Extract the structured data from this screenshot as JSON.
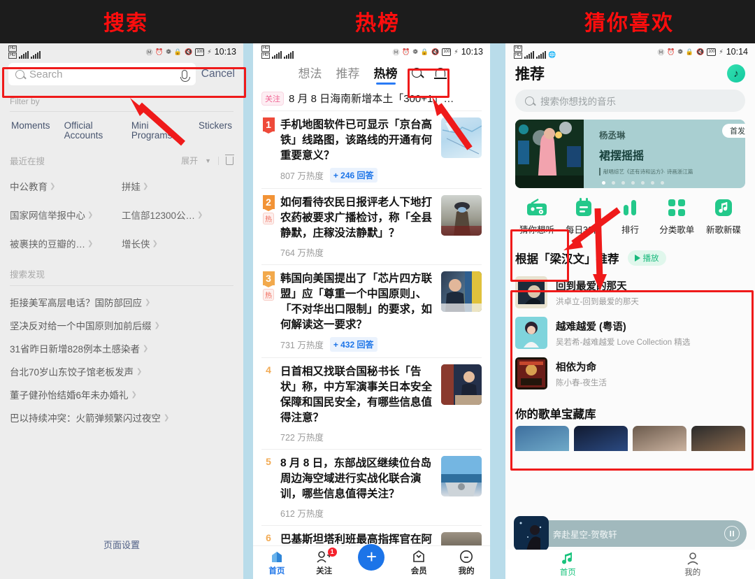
{
  "captions": {
    "left": "搜索",
    "middle": "热榜",
    "right": "猜你喜欢"
  },
  "panel1": {
    "statusbar": {
      "time": "10:13",
      "battery": "100",
      "hd": "HD"
    },
    "search": {
      "placeholder": "Search",
      "cancel_label": "Cancel",
      "mic_icon": "mic-icon",
      "search_icon": "search-icon"
    },
    "filter_label": "Filter by",
    "filters": [
      "Moments",
      "Official Accounts",
      "Mini Programs",
      "Stickers"
    ],
    "recent": {
      "label": "最近在搜",
      "expand_label": "展开",
      "delete_icon": "trash-icon"
    },
    "recent_items": [
      "中公教育",
      "拼娃",
      "国家网信举报中心",
      "工信部12300公…",
      "被裹挟的豆瓣的…",
      "增长侠"
    ],
    "discover_label": "搜索发现",
    "discover_items": [
      "拒接美军高层电话？国防部回应",
      "坚决反对给一个中国原则加前后缀",
      "31省昨日新增828例本土感染者",
      "台北70岁山东饺子馆老板发声",
      "董子健孙怡结婚6年未办婚礼",
      "巴以持续冲突：火箭弹频繁闪过夜空"
    ],
    "page_setting": "页面设置"
  },
  "panel2": {
    "statusbar": {
      "time": "10:13",
      "battery": "100"
    },
    "tabs": [
      {
        "label": "想法",
        "active": false
      },
      {
        "label": "推荐",
        "active": false
      },
      {
        "label": "热榜",
        "active": true
      }
    ],
    "search_icon": "search-icon",
    "bell_icon": "bell-icon",
    "banner": {
      "tag": "关注",
      "text": "8 月 8 日海南新增本土「300+1」…"
    },
    "items": [
      {
        "rank": "1",
        "hot": "",
        "title": "手机地图软件已可显示「京台高铁」线路图，该路线的开通有何重要意义？",
        "heat": "807 万热度",
        "answers": "+ 246 回答",
        "thumb": "map-thumbnail"
      },
      {
        "rank": "2",
        "hot": "热",
        "title": "如何看待农民日报评老人下地打农药被要求广播检讨，称「全县静默，庄稼没法静默」？",
        "heat": "764 万热度",
        "answers": "",
        "thumb": "farmer-thumbnail"
      },
      {
        "rank": "3",
        "hot": "热",
        "title": "韩国向美国提出了「芯片四方联盟」应「尊重一个中国原则」、「不对华出口限制」的要求，如何解读这一要求？",
        "heat": "731 万热度",
        "answers": "+ 432 回答",
        "thumb": "politician-thumbnail"
      },
      {
        "rank": "4",
        "hot": "",
        "title": "日首相又找联合国秘书长「告状」称，中方军演事关日本安全保障和国民安全，有哪些信息值得注意？",
        "heat": "722 万热度",
        "answers": "",
        "thumb": "podium-thumbnail"
      },
      {
        "rank": "5",
        "hot": "",
        "title": "8 月 8 日，东部战区继续位台岛周边海空域进行实战化联合演训，哪些信息值得关注？",
        "heat": "612 万热度",
        "answers": "",
        "thumb": "sea-thumbnail"
      },
      {
        "rank": "6",
        "hot": "",
        "title": "巴基斯坦塔利班最高指挥官在阿富",
        "heat": "",
        "answers": "",
        "thumb": "desert-thumbnail"
      }
    ],
    "nav": [
      {
        "label": "首页",
        "icon": "home-icon",
        "active": true,
        "badge": ""
      },
      {
        "label": "关注",
        "icon": "follow-icon",
        "active": false,
        "badge": "1"
      },
      {
        "label": "",
        "icon": "plus-icon",
        "active": false,
        "badge": ""
      },
      {
        "label": "会员",
        "icon": "vip-icon",
        "active": false,
        "badge": ""
      },
      {
        "label": "我的",
        "icon": "profile-icon",
        "active": false,
        "badge": ""
      }
    ]
  },
  "panel3": {
    "statusbar": {
      "time": "10:14",
      "battery": "100"
    },
    "title": "推荐",
    "logo_icon": "music-note-logo",
    "search_placeholder": "搜索你想找的音乐",
    "hero": {
      "badge": "首发",
      "artist": "杨丞琳",
      "song": "裙摆摇摇",
      "subtitle": "献唱综艺《还有诗和远方》· 诗画浙江篇",
      "dots": 7,
      "active_dot": 0
    },
    "quick_actions": [
      {
        "label": "猜你想听",
        "icon": "radio-icon"
      },
      {
        "label": "每日30首",
        "icon": "calendar-icon"
      },
      {
        "label": "排行",
        "icon": "chart-bars-icon"
      },
      {
        "label": "分类歌单",
        "icon": "grid-icon"
      },
      {
        "label": "新歌新碟",
        "icon": "music-note-icon"
      }
    ],
    "recommend": {
      "title": "根据「梁汉文」推荐",
      "play_label": "播放",
      "songs": [
        {
          "name": "回到最爱的那天",
          "sub": "洪卓立-回到最爱的那天",
          "cover": "album-cover-1"
        },
        {
          "name": "越难越爱 (粤语)",
          "sub": "吴若希-越难越爱 Love Collection 精选",
          "cover": "album-cover-2"
        },
        {
          "name": "相依为命",
          "sub": "陈小春-夜生活",
          "cover": "album-cover-3"
        }
      ]
    },
    "library_title": "你的歌单宝藏库",
    "miniplayer": {
      "title": "奔赴星空-贺敬轩",
      "pause_icon": "pause-icon",
      "cover": "player-cover"
    },
    "nav": [
      {
        "label": "首页",
        "icon": "music-home-icon",
        "active": true
      },
      {
        "label": "我的",
        "icon": "person-icon",
        "active": false
      }
    ]
  },
  "annotations": {
    "accent_color": "#ef1a1a",
    "boxes": [
      {
        "name": "search-bar-highlight"
      },
      {
        "name": "hot-tab-highlight"
      },
      {
        "name": "guess-you-like-highlight"
      },
      {
        "name": "recommend-section-highlight"
      }
    ]
  }
}
